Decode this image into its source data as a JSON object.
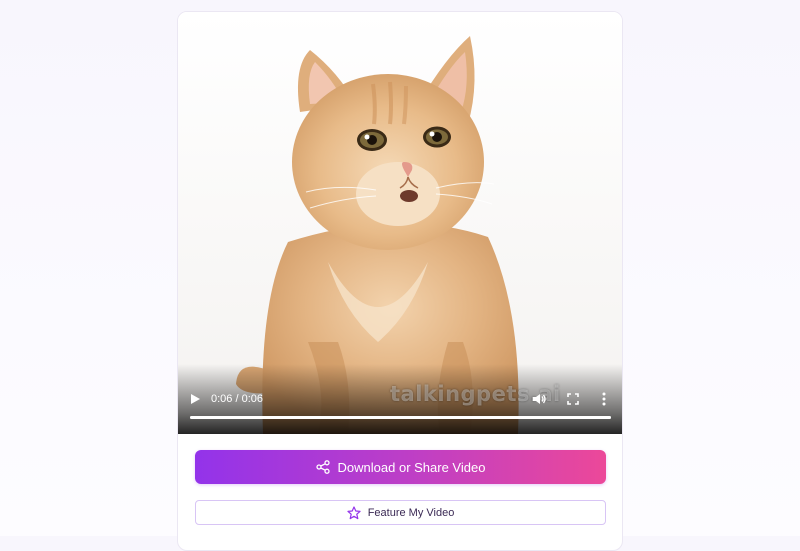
{
  "video": {
    "current_time": "0:06",
    "duration": "0:06",
    "time_display": "0:06 / 0:06",
    "watermark": "talkingpets.ai",
    "progress": 1.0,
    "controls": {
      "play_icon": "play-icon",
      "volume_icon": "volume-icon",
      "fullscreen_icon": "fullscreen-icon",
      "more_icon": "more-vertical-icon"
    }
  },
  "actions": {
    "download_label": "Download or Share Video",
    "download_icon": "share-icon",
    "feature_label": "Feature My Video",
    "feature_icon": "star-icon"
  },
  "colors": {
    "gradient_start": "#9333ea",
    "gradient_end": "#ec4899",
    "feature_border": "#d8c5f5"
  }
}
